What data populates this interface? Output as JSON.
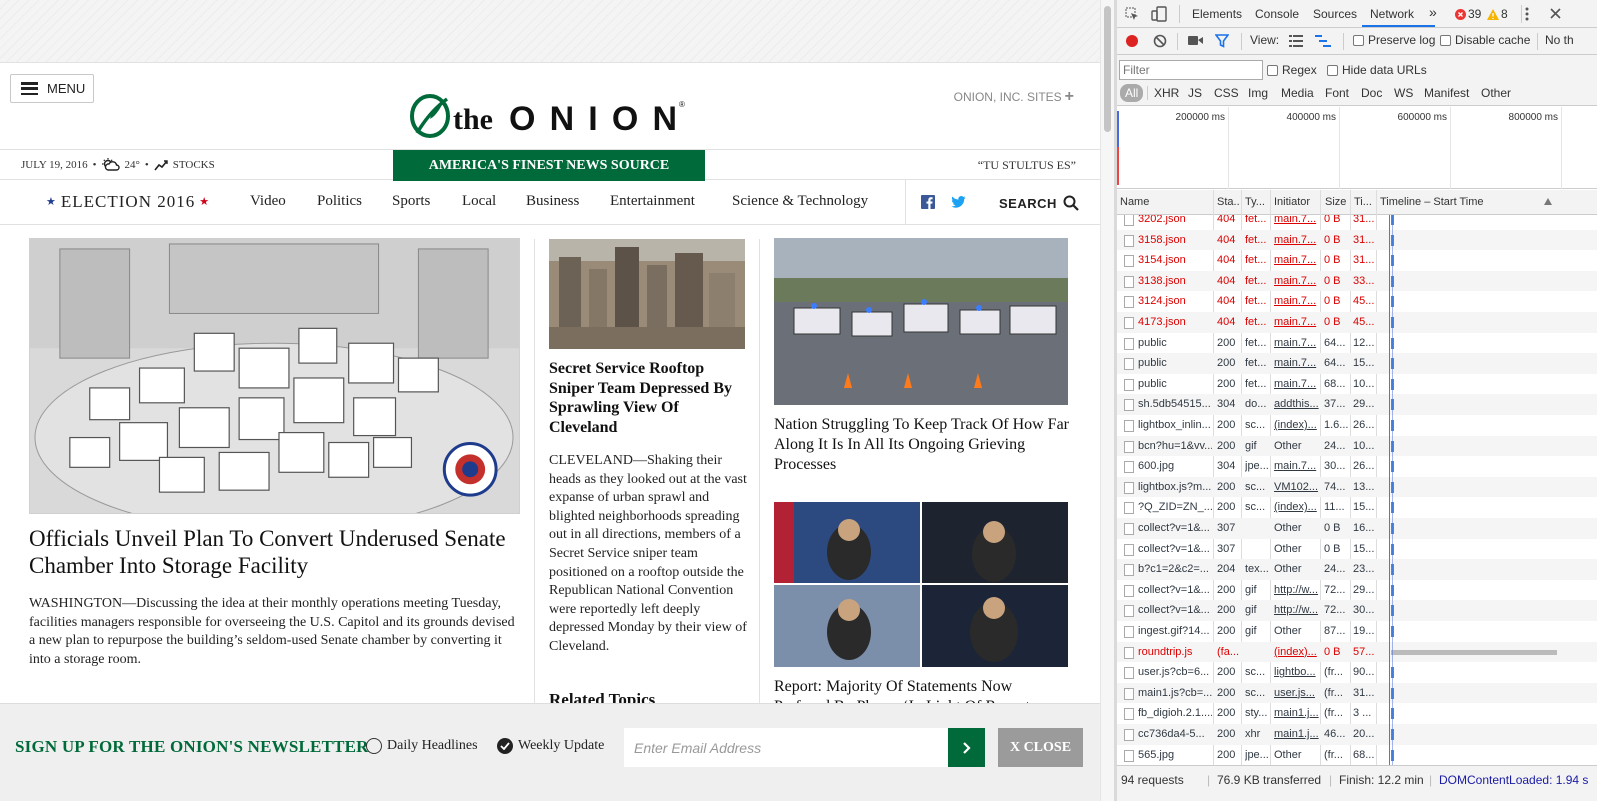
{
  "site": {
    "menu_label": "MENU",
    "logo_text": "the ONION",
    "onion_sites": "ONION, INC. SITES",
    "date": "JULY 19, 2016",
    "temp": "24°",
    "stocks": "STOCKS",
    "tagline": "AMERICA'S FINEST NEWS SOURCE",
    "motto": "“TU STULTUS ES”",
    "election": "ELECTION 2016",
    "nav": [
      "Video",
      "Politics",
      "Sports",
      "Local",
      "Business",
      "Entertainment",
      "Science & Technology"
    ],
    "search_label": "SEARCH",
    "main_story": {
      "headline": "Officials Unveil Plan To Convert Underused Senate Chamber Into Storage Facility",
      "body": "WASHINGTON—Discussing the idea at their monthly operations meeting Tuesday, facilities managers responsible for overseeing the U.S. Capitol and its grounds devised a new plan to repurpose the building’s seldom-used Senate chamber by converting it into a storage room."
    },
    "mid_story": {
      "headline": "Secret Service Rooftop Sniper Team Depressed By Sprawling View Of Cleveland",
      "body": "CLEVELAND—Shaking their heads as they looked out at the vast expanse of urban sprawl and blighted neighborhoods spreading out in all directions, members of a Secret Service sniper team positioned on a rooftop outside the Republican National Convention were reportedly left deeply depressed Monday by their view of Cleveland.",
      "related": "Related Topics"
    },
    "right_story_1": "Nation Struggling To Keep Track Of How Far Along It Is In All Its Ongoing Grieving Processes",
    "right_story_2": "Report: Majority Of Statements Now Prefaced By Phrase ‘In Light Of Recent"
  },
  "newsletter": {
    "title": "SIGN UP FOR THE ONION'S NEWSLETTER",
    "option_daily": "Daily Headlines",
    "option_weekly": "Weekly Update",
    "email_placeholder": "Enter Email Address",
    "close_label": "X CLOSE"
  },
  "devtools": {
    "tabs": [
      "Elements",
      "Console",
      "Sources",
      "Network"
    ],
    "active_tab": "Network",
    "more": "»",
    "errors": "39",
    "warnings": "8",
    "view_label": "View:",
    "preserve_log": "Preserve log",
    "disable_cache": "Disable cache",
    "throttle": "No th",
    "filter_placeholder": "Filter",
    "regex": "Regex",
    "hide_data_urls": "Hide data URLs",
    "types": [
      "All",
      "XHR",
      "JS",
      "CSS",
      "Img",
      "Media",
      "Font",
      "Doc",
      "WS",
      "Manifest",
      "Other"
    ],
    "overview_ticks": [
      "200000 ms",
      "400000 ms",
      "600000 ms",
      "800000 ms"
    ],
    "columns": [
      "Name",
      "Sta..",
      "Ty...",
      "Initiator",
      "Size",
      "Ti...",
      "Timeline – Start Time"
    ],
    "rows": [
      {
        "name": "3202.json",
        "status": "404",
        "type": "fet...",
        "initiator": "main.7...",
        "size": "0 B",
        "time": "31...",
        "error": true
      },
      {
        "name": "3158.json",
        "status": "404",
        "type": "fet...",
        "initiator": "main.7...",
        "size": "0 B",
        "time": "31...",
        "error": true
      },
      {
        "name": "3154.json",
        "status": "404",
        "type": "fet...",
        "initiator": "main.7...",
        "size": "0 B",
        "time": "31...",
        "error": true
      },
      {
        "name": "3138.json",
        "status": "404",
        "type": "fet...",
        "initiator": "main.7...",
        "size": "0 B",
        "time": "33...",
        "error": true
      },
      {
        "name": "3124.json",
        "status": "404",
        "type": "fet...",
        "initiator": "main.7...",
        "size": "0 B",
        "time": "45...",
        "error": true
      },
      {
        "name": "4173.json",
        "status": "404",
        "type": "fet...",
        "initiator": "main.7...",
        "size": "0 B",
        "time": "45...",
        "error": true
      },
      {
        "name": "public",
        "status": "200",
        "type": "fet...",
        "initiator": "main.7...",
        "size": "64...",
        "time": "12...",
        "error": false
      },
      {
        "name": "public",
        "status": "200",
        "type": "fet...",
        "initiator": "main.7...",
        "size": "64...",
        "time": "15...",
        "error": false
      },
      {
        "name": "public",
        "status": "200",
        "type": "fet...",
        "initiator": "main.7...",
        "size": "68...",
        "time": "10...",
        "error": false
      },
      {
        "name": "sh.5db54515...",
        "status": "304",
        "type": "do...",
        "initiator": "addthis...",
        "size": "37...",
        "time": "29...",
        "error": false
      },
      {
        "name": "lightbox_inlin...",
        "status": "200",
        "type": "sc...",
        "initiator": "(index)...",
        "size": "1.6...",
        "time": "26...",
        "error": false
      },
      {
        "name": "bcn?hu=1&vv...",
        "status": "200",
        "type": "gif",
        "initiator": "Other",
        "size": "24...",
        "time": "10...",
        "error": false
      },
      {
        "name": "600.jpg",
        "status": "304",
        "type": "jpe...",
        "initiator": "main.7...",
        "size": "30...",
        "time": "26...",
        "error": false
      },
      {
        "name": "lightbox.js?m...",
        "status": "200",
        "type": "sc...",
        "initiator": "VM102...",
        "size": "74...",
        "time": "13...",
        "error": false
      },
      {
        "name": "?Q_ZID=ZN_...",
        "status": "200",
        "type": "sc...",
        "initiator": "(index)...",
        "size": "11...",
        "time": "15...",
        "error": false
      },
      {
        "name": "collect?v=1&...",
        "status": "307",
        "type": "",
        "initiator": "Other",
        "size": "0 B",
        "time": "16...",
        "error": false
      },
      {
        "name": "collect?v=1&...",
        "status": "307",
        "type": "",
        "initiator": "Other",
        "size": "0 B",
        "time": "15...",
        "error": false
      },
      {
        "name": "b?c1=2&c2=...",
        "status": "204",
        "type": "tex...",
        "initiator": "Other",
        "size": "24...",
        "time": "23...",
        "error": false
      },
      {
        "name": "collect?v=1&...",
        "status": "200",
        "type": "gif",
        "initiator": "http://w...",
        "size": "72...",
        "time": "29...",
        "error": false
      },
      {
        "name": "collect?v=1&...",
        "status": "200",
        "type": "gif",
        "initiator": "http://w...",
        "size": "72...",
        "time": "30...",
        "error": false
      },
      {
        "name": "ingest.gif?14...",
        "status": "200",
        "type": "gif",
        "initiator": "Other",
        "size": "87...",
        "time": "19...",
        "error": false
      },
      {
        "name": "roundtrip.js",
        "status": "(fa...",
        "type": "",
        "initiator": "(index)...",
        "size": "0 B",
        "time": "57...",
        "error": true
      },
      {
        "name": "user.js?cb=6...",
        "status": "200",
        "type": "sc...",
        "initiator": "lightbo...",
        "size": "(fr...",
        "time": "90...",
        "error": false
      },
      {
        "name": "main1.js?cb=...",
        "status": "200",
        "type": "sc...",
        "initiator": "user.js...",
        "size": "(fr...",
        "time": "31...",
        "error": false
      },
      {
        "name": "fb_digioh.2.1....",
        "status": "200",
        "type": "sty...",
        "initiator": "main1.j...",
        "size": "(fr...",
        "time": "3 ...",
        "error": false
      },
      {
        "name": "cc736da4-5...",
        "status": "200",
        "type": "xhr",
        "initiator": "main1.j...",
        "size": "46...",
        "time": "20...",
        "error": false
      },
      {
        "name": "565.jpg",
        "status": "200",
        "type": "jpe...",
        "initiator": "Other",
        "size": "(fr...",
        "time": "68...",
        "error": false
      }
    ],
    "summary": {
      "requests": "94 requests",
      "transferred": "76.9 KB transferred",
      "finish": "Finish: 12.2 min",
      "dcl": "DOMContentLoaded: 1.94 s"
    }
  },
  "colors": {
    "onion_green": "#006a3a",
    "error_red": "#dd0000",
    "devtools_blue": "#1a73e8"
  }
}
